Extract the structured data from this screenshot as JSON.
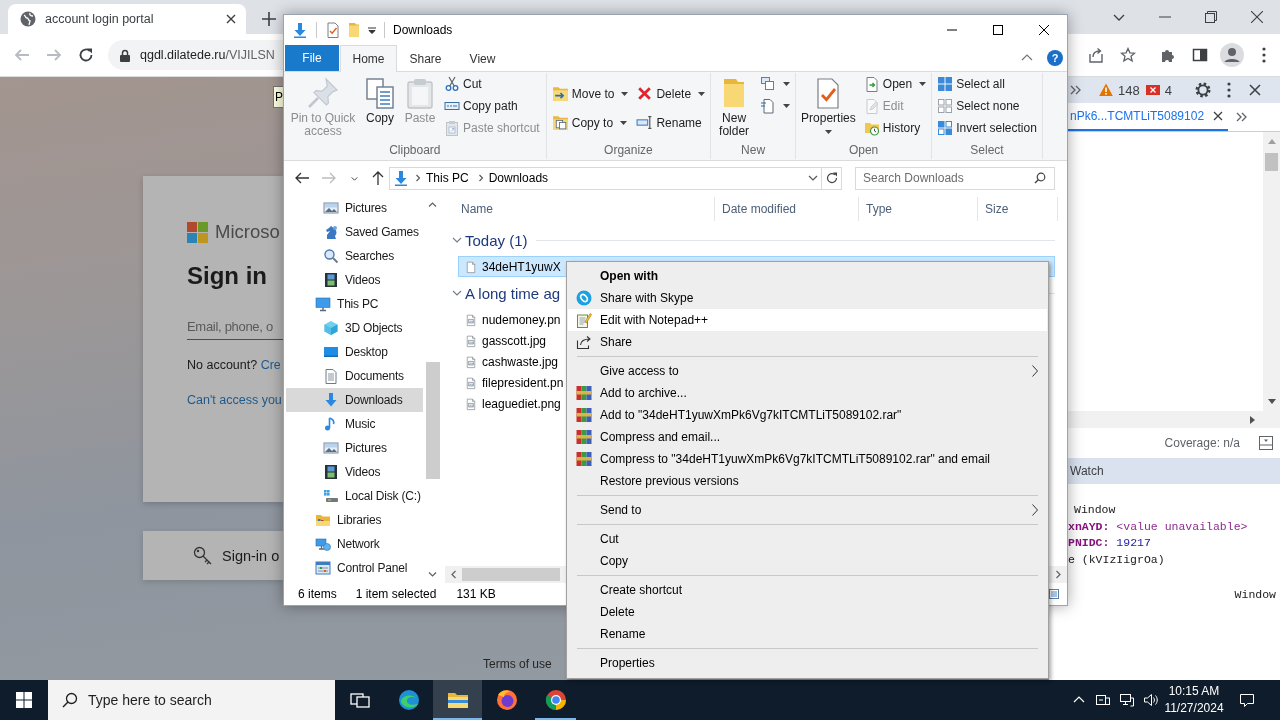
{
  "browser": {
    "tabs": [
      {
        "title": "account login portal",
        "selected": true
      }
    ],
    "nav_buttons": [
      {
        "kind": "back",
        "disabled": true
      },
      {
        "kind": "forward",
        "disabled": true
      },
      {
        "kind": "reload",
        "disabled": false
      }
    ],
    "address": {
      "domain": "qgdl.dilatede.ru",
      "path": "/VIJILSN"
    },
    "tooltip": "P",
    "page": {
      "logo_text": "Microso",
      "heading": "Sign in",
      "email_placeholder": "Email, phone, o",
      "no_account": "No account?",
      "create_link": "Cre",
      "access_link": "Can't access you",
      "signin_options": "Sign-in o",
      "footer_link": "Terms of use"
    },
    "devtools": {
      "warnings": "148",
      "errors": "4",
      "file_tab": {
        "label": "nPk6...TCMTLiT5089102",
        "selected": true
      },
      "coverage": "Coverage: n/a",
      "section": "Watch",
      "scope": [
        {
          "kind": "plain",
          "text": "Window"
        },
        {
          "kind": "unavailable",
          "key": "xnAYD:",
          "value": "<value unavailable>"
        },
        {
          "kind": "number",
          "key": "PNIDC:",
          "value": "19217"
        },
        {
          "kind": "plain",
          "text": "e (kVIzIigrOa)"
        },
        {
          "kind": "type",
          "text": "Window"
        }
      ]
    }
  },
  "explorer": {
    "title": "Downloads",
    "help": "?",
    "ribbon_tabs": [
      {
        "label": "File",
        "kind": "menu",
        "selected": false
      },
      {
        "label": "Home",
        "kind": "tab",
        "selected": true
      },
      {
        "label": "Share",
        "kind": "tab",
        "selected": false
      },
      {
        "label": "View",
        "kind": "tab",
        "selected": false
      }
    ],
    "ribbon_groups": [
      {
        "label": "Clipboard",
        "columns": [
          [
            {
              "kind": "pin",
              "label": "Pin to Quick access",
              "disabled": true,
              "dropdown": false
            }
          ],
          [
            {
              "kind": "copy",
              "label": "Copy",
              "disabled": false,
              "dropdown": false
            }
          ],
          [
            {
              "kind": "paste",
              "label": "Paste",
              "disabled": true,
              "dropdown": false
            }
          ],
          [
            {
              "kind": "cut",
              "label": "Cut",
              "disabled": false,
              "dropdown": false
            },
            {
              "kind": "copy-path",
              "label": "Copy path",
              "disabled": false,
              "dropdown": false
            },
            {
              "kind": "paste-shortcut",
              "label": "Paste shortcut",
              "disabled": true,
              "dropdown": false
            }
          ]
        ]
      },
      {
        "label": "Organize",
        "columns": [
          [
            {
              "kind": "move-to",
              "label": "Move to",
              "disabled": false,
              "dropdown": true
            },
            {
              "kind": "copy-to",
              "label": "Copy to",
              "disabled": false,
              "dropdown": true
            }
          ],
          [
            {
              "kind": "delete",
              "label": "Delete",
              "disabled": false,
              "dropdown": true
            },
            {
              "kind": "rename",
              "label": "Rename",
              "disabled": false,
              "dropdown": false
            }
          ]
        ]
      },
      {
        "label": "New",
        "columns": [
          [
            {
              "kind": "new-folder",
              "label": "New folder",
              "disabled": false,
              "dropdown": false
            }
          ],
          [
            {
              "kind": "new-item",
              "disabled": false,
              "dropdown": true
            },
            {
              "kind": "easy-access",
              "disabled": false,
              "dropdown": true
            }
          ]
        ]
      },
      {
        "label": "Open",
        "columns": [
          [
            {
              "kind": "properties",
              "label": "Properties",
              "disabled": false,
              "dropdown": true
            }
          ],
          [
            {
              "kind": "open",
              "label": "Open",
              "disabled": false,
              "dropdown": true
            },
            {
              "kind": "edit",
              "label": "Edit",
              "disabled": true,
              "dropdown": false
            },
            {
              "kind": "history",
              "label": "History",
              "disabled": false,
              "dropdown": false
            }
          ]
        ]
      },
      {
        "label": "Select",
        "columns": [
          [
            {
              "kind": "select-all",
              "label": "Select all",
              "disabled": false,
              "dropdown": false
            },
            {
              "kind": "select-none",
              "label": "Select none",
              "disabled": false,
              "dropdown": false
            },
            {
              "kind": "invert-selection",
              "label": "Invert selection",
              "disabled": false,
              "dropdown": false
            }
          ]
        ]
      }
    ],
    "nav_buttons": [
      {
        "kind": "back",
        "disabled": false
      },
      {
        "kind": "forward",
        "disabled": true
      },
      {
        "kind": "recent",
        "disabled": false
      },
      {
        "kind": "up",
        "disabled": false
      }
    ],
    "breadcrumb": [
      "This PC",
      "Downloads"
    ],
    "search_placeholder": "Search Downloads",
    "nav_pane": {
      "continued_children": [
        {
          "label": "Pictures",
          "kind": "pictures",
          "selected": false
        },
        {
          "label": "Saved Games",
          "kind": "games",
          "selected": false
        },
        {
          "label": "Searches",
          "kind": "searches",
          "selected": false
        },
        {
          "label": "Videos",
          "kind": "videos",
          "selected": false
        }
      ],
      "items": [
        {
          "label": "This PC",
          "kind": "pc",
          "selected": false,
          "children": [
            {
              "label": "3D Objects",
              "kind": "objects",
              "selected": false
            },
            {
              "label": "Desktop",
              "kind": "desktop",
              "selected": false
            },
            {
              "label": "Documents",
              "kind": "documents",
              "selected": false
            },
            {
              "label": "Downloads",
              "kind": "downloads",
              "selected": true
            },
            {
              "label": "Music",
              "kind": "music",
              "selected": false
            },
            {
              "label": "Pictures",
              "kind": "pictures",
              "selected": false
            },
            {
              "label": "Videos",
              "kind": "videos",
              "selected": false
            },
            {
              "label": "Local Disk (C:)",
              "kind": "drive",
              "selected": false
            }
          ]
        },
        {
          "label": "Libraries",
          "kind": "libraries",
          "selected": false
        },
        {
          "label": "Network",
          "kind": "network",
          "selected": false
        },
        {
          "label": "Control Panel",
          "kind": "controlpanel",
          "selected": false
        }
      ]
    },
    "columns": [
      "Name",
      "Date modified",
      "Type",
      "Size"
    ],
    "groups": [
      {
        "label": "Today (1)",
        "expanded": true,
        "files": [
          {
            "name": "34deHT1yuwX",
            "kind": "document",
            "selected": true
          }
        ]
      },
      {
        "label": "A long time ag",
        "expanded": true,
        "files": [
          {
            "name": "nudemoney.pn",
            "kind": "image",
            "selected": false
          },
          {
            "name": "gasscott.jpg",
            "kind": "image",
            "selected": false
          },
          {
            "name": "cashwaste.jpg",
            "kind": "image",
            "selected": false
          },
          {
            "name": "filepresident.pn",
            "kind": "image",
            "selected": false
          },
          {
            "name": "leaguediet.png",
            "kind": "image",
            "selected": false
          }
        ]
      }
    ],
    "status": {
      "count": "6 items",
      "selection": "1 item selected",
      "size": "131 KB"
    }
  },
  "context_menu": {
    "groups": [
      {
        "items": [
          {
            "label": "Open with",
            "kind": "default",
            "selected": false
          },
          {
            "label": "Share with Skype",
            "kind": "skype",
            "selected": false
          },
          {
            "label": "Edit with Notepad++",
            "kind": "notepad",
            "selected": true
          },
          {
            "label": "Share",
            "kind": "share",
            "selected": false
          }
        ]
      },
      {
        "items": [
          {
            "label": "Give access to",
            "kind": "submenu",
            "selected": false
          },
          {
            "label": "Add to archive...",
            "kind": "archive",
            "selected": false
          },
          {
            "label": "Add to \"34deHT1yuwXmPk6Vg7kITCMTLiT5089102.rar\"",
            "kind": "archive",
            "selected": false
          },
          {
            "label": "Compress and email...",
            "kind": "archive",
            "selected": false
          },
          {
            "label": "Compress to \"34deHT1yuwXmPk6Vg7kITCMTLiT5089102.rar\" and email",
            "kind": "archive",
            "selected": false
          },
          {
            "label": "Restore previous versions",
            "kind": "plain",
            "selected": false
          }
        ]
      },
      {
        "items": [
          {
            "label": "Send to",
            "kind": "submenu",
            "selected": false
          }
        ]
      },
      {
        "items": [
          {
            "label": "Cut",
            "kind": "plain",
            "selected": false
          },
          {
            "label": "Copy",
            "kind": "plain",
            "selected": false
          }
        ]
      },
      {
        "items": [
          {
            "label": "Create shortcut",
            "kind": "plain",
            "selected": false
          },
          {
            "label": "Delete",
            "kind": "plain",
            "selected": false
          },
          {
            "label": "Rename",
            "kind": "plain",
            "selected": false
          }
        ]
      },
      {
        "items": [
          {
            "label": "Properties",
            "kind": "plain",
            "selected": false
          }
        ]
      }
    ]
  },
  "taskbar": {
    "search_placeholder": "Type here to search",
    "apps": [
      {
        "kind": "taskview",
        "running": false,
        "active": false
      },
      {
        "kind": "edge",
        "running": false,
        "active": false
      },
      {
        "kind": "explorer",
        "running": true,
        "active": true
      },
      {
        "kind": "firefox",
        "running": false,
        "active": false
      },
      {
        "kind": "chrome",
        "running": true,
        "active": false
      }
    ],
    "time": "10:15 AM",
    "date": "11/27/2024"
  }
}
